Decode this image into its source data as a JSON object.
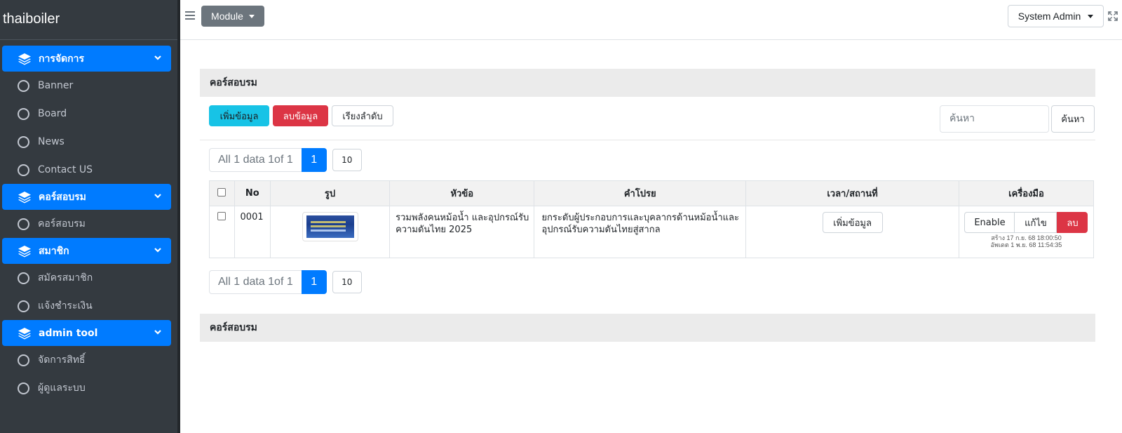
{
  "brand": "thaiboiler",
  "sidebar": {
    "groups": [
      {
        "label": "การจัดการ",
        "items": [
          "Banner",
          "Board",
          "News",
          "Contact US"
        ]
      },
      {
        "label": "คอร์สอบรม",
        "items": [
          "คอร์สอบรม"
        ]
      },
      {
        "label": "สมาชิก",
        "items": [
          "สมัครสมาชิก",
          "แจ้งชำระเงิน"
        ]
      },
      {
        "label": "admin tool",
        "items": [
          "จัดการสิทธิ์",
          "ผู้ดูแลระบบ"
        ]
      }
    ]
  },
  "topbar": {
    "module_label": "Module",
    "user_label": "System Admin"
  },
  "card": {
    "title": "คอร์สอบรม",
    "add_label": "เพิ่มข้อมูล",
    "delete_label": "ลบข้อมูล",
    "sort_label": "เรียงลำดับ",
    "search_placeholder": "ค้นหา",
    "search_button": "ค้นหา",
    "footer_title": "คอร์สอบรม"
  },
  "pager": {
    "info": "All 1 data 1of 1",
    "page": "1",
    "page_size": "10"
  },
  "table": {
    "headers": {
      "no": "No",
      "image": "รูป",
      "title": "หัวข้อ",
      "description": "คำโปรย",
      "time_place": "เวลา/สถานที่",
      "tools": "เครื่องมือ"
    },
    "rows": [
      {
        "no": "0001",
        "title": "รวมพลังคนหม้อน้ำ และอุปกรณ์รับความดันไทย 2025",
        "description": "ยกระดับผู้ประกอบการและบุคลากรด้านหม้อน้ำและอุปกรณ์รับความดันไทยสู่สากล",
        "time_place_button": "เพิ่มข้อมูล",
        "enable_label": "Enable",
        "edit_label": "แก้ไข",
        "delete_label": "ลบ",
        "created": "สร้าง 17 ก.ย. 68 18:00:50",
        "updated": "อัพเดต 1 พ.ย. 68 11:54:35"
      }
    ]
  },
  "colors": {
    "primary": "#007bff",
    "info": "#17c3e6",
    "danger": "#dc3545",
    "sidebar": "#343a40",
    "secondary": "#6c757d"
  }
}
